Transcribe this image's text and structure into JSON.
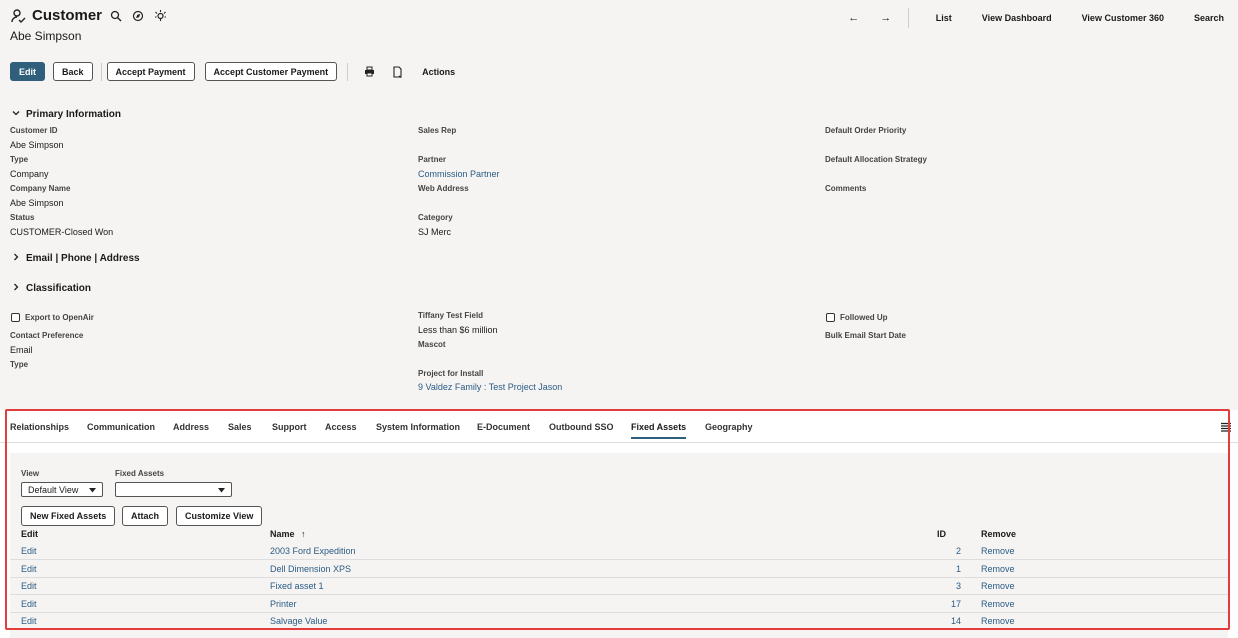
{
  "header": {
    "record_type": "Customer",
    "record_name": "Abe Simpson",
    "nav": {
      "back_arrow": "←",
      "forward_arrow": "→",
      "list": "List",
      "view_dashboard": "View Dashboard",
      "view_customer_360": "View Customer 360",
      "search": "Search"
    }
  },
  "toolbar": {
    "edit": "Edit",
    "back": "Back",
    "accept_payment": "Accept Payment",
    "accept_customer_payment": "Accept Customer Payment",
    "actions": "Actions"
  },
  "primary": {
    "title": "Primary Information",
    "customer_id_label": "Customer ID",
    "customer_id": "Abe Simpson",
    "type_label": "Type",
    "type": "Company",
    "company_name_label": "Company Name",
    "company_name": "Abe Simpson",
    "status_label": "Status",
    "status": "CUSTOMER-Closed Won",
    "sales_rep_label": "Sales Rep",
    "partner_label": "Partner",
    "partner": "Commission Partner",
    "web_address_label": "Web Address",
    "category_label": "Category",
    "category": "SJ Merc",
    "default_order_priority_label": "Default Order Priority",
    "default_allocation_label": "Default Allocation Strategy",
    "comments_label": "Comments"
  },
  "email_section": {
    "title": "Email | Phone | Address"
  },
  "classification": {
    "title": "Classification",
    "export_openair_label": "Export to OpenAir",
    "contact_pref_label": "Contact Preference",
    "contact_pref": "Email",
    "type_label": "Type",
    "tiffany_label": "Tiffany Test Field",
    "tiffany": "Less than $6 million",
    "mascot_label": "Mascot",
    "project_label": "Project for Install",
    "project": "9 Valdez Family : Test Project Jason",
    "followed_up_label": "Followed Up",
    "bulk_email_label": "Bulk Email Start Date"
  },
  "tabs": [
    "Relationships",
    "Communication",
    "Address",
    "Sales",
    "Support",
    "Access",
    "System Information",
    "E-Document",
    "Outbound SSO",
    "Fixed Assets",
    "Geography"
  ],
  "active_tab": "Fixed Assets",
  "fixed_assets": {
    "view_label": "View",
    "view_value": "Default View",
    "filter_label": "Fixed Assets",
    "filter_value": "",
    "new_button": "New Fixed Assets",
    "attach_button": "Attach",
    "customize_button": "Customize View",
    "columns": {
      "edit": "Edit",
      "name": "Name",
      "sort_indicator": "↑",
      "id": "ID",
      "remove": "Remove"
    },
    "rows": [
      {
        "edit": "Edit",
        "name": "2003 Ford Expedition",
        "id": "2",
        "remove": "Remove"
      },
      {
        "edit": "Edit",
        "name": "Dell Dimension XPS",
        "id": "1",
        "remove": "Remove"
      },
      {
        "edit": "Edit",
        "name": "Fixed asset 1",
        "id": "3",
        "remove": "Remove"
      },
      {
        "edit": "Edit",
        "name": "Printer",
        "id": "17",
        "remove": "Remove"
      },
      {
        "edit": "Edit",
        "name": "Salvage Value",
        "id": "14",
        "remove": "Remove"
      }
    ]
  },
  "colors": {
    "primary_button": "#2f5f7a",
    "link": "#2a5b85",
    "highlight_box": "#e23c3c"
  }
}
